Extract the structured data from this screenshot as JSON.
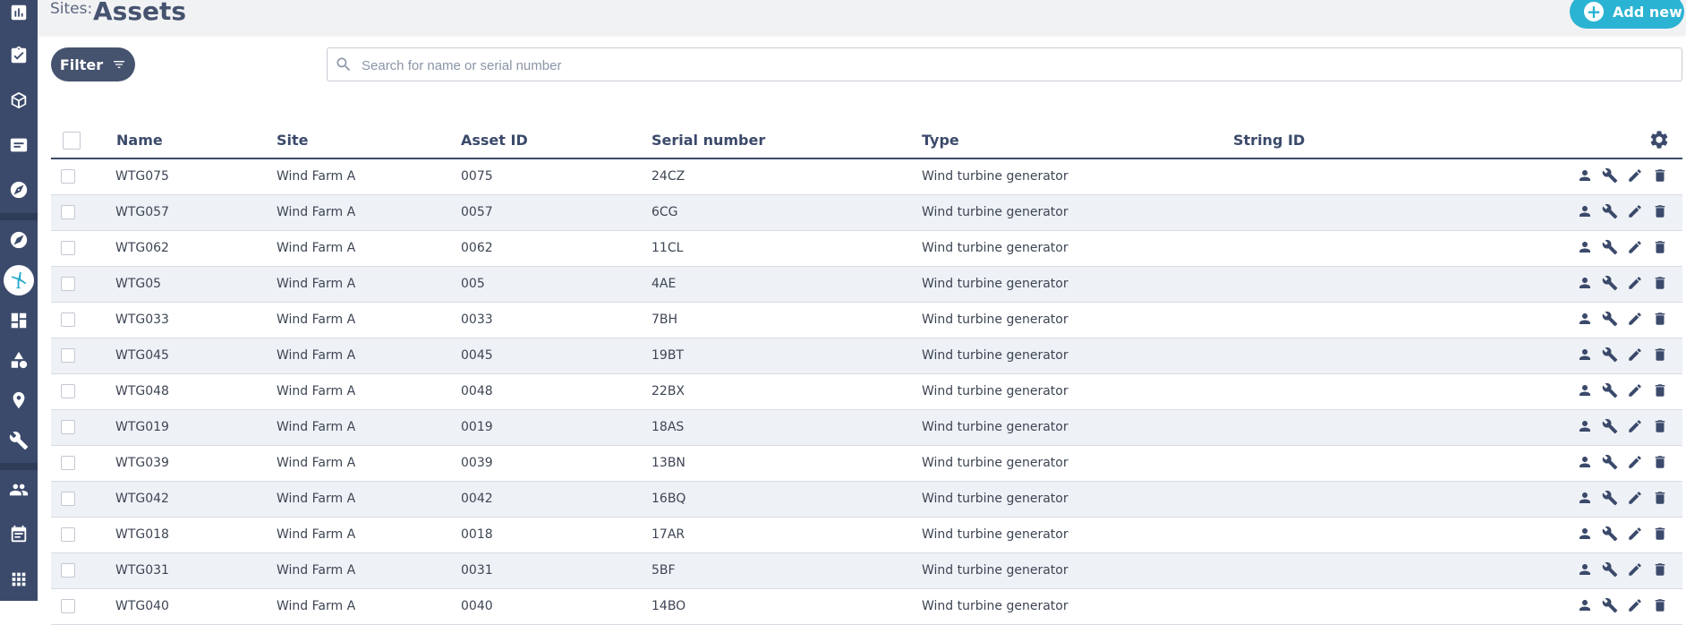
{
  "header": {
    "crumb": "Sites:",
    "title": "Assets",
    "add_new": "Add new"
  },
  "toolbar": {
    "filter": "Filter",
    "search_placeholder": "Search for name or serial number"
  },
  "table": {
    "columns": [
      "Name",
      "Site",
      "Asset ID",
      "Serial number",
      "Type",
      "String ID"
    ],
    "rows": [
      {
        "name": "WTG075",
        "site": "Wind Farm A",
        "asset_id": "0075",
        "serial": "24CZ",
        "type": "Wind turbine generator",
        "string_id": ""
      },
      {
        "name": "WTG057",
        "site": "Wind Farm A",
        "asset_id": "0057",
        "serial": "6CG",
        "type": "Wind turbine generator",
        "string_id": ""
      },
      {
        "name": "WTG062",
        "site": "Wind Farm A",
        "asset_id": "0062",
        "serial": "11CL",
        "type": "Wind turbine generator",
        "string_id": ""
      },
      {
        "name": "WTG05",
        "site": "Wind Farm A",
        "asset_id": "005",
        "serial": "4AE",
        "type": "Wind turbine generator",
        "string_id": ""
      },
      {
        "name": "WTG033",
        "site": "Wind Farm A",
        "asset_id": "0033",
        "serial": "7BH",
        "type": "Wind turbine generator",
        "string_id": ""
      },
      {
        "name": "WTG045",
        "site": "Wind Farm A",
        "asset_id": "0045",
        "serial": "19BT",
        "type": "Wind turbine generator",
        "string_id": ""
      },
      {
        "name": "WTG048",
        "site": "Wind Farm A",
        "asset_id": "0048",
        "serial": "22BX",
        "type": "Wind turbine generator",
        "string_id": ""
      },
      {
        "name": "WTG019",
        "site": "Wind Farm A",
        "asset_id": "0019",
        "serial": "18AS",
        "type": "Wind turbine generator",
        "string_id": ""
      },
      {
        "name": "WTG039",
        "site": "Wind Farm A",
        "asset_id": "0039",
        "serial": "13BN",
        "type": "Wind turbine generator",
        "string_id": ""
      },
      {
        "name": "WTG042",
        "site": "Wind Farm A",
        "asset_id": "0042",
        "serial": "16BQ",
        "type": "Wind turbine generator",
        "string_id": ""
      },
      {
        "name": "WTG018",
        "site": "Wind Farm A",
        "asset_id": "0018",
        "serial": "17AR",
        "type": "Wind turbine generator",
        "string_id": ""
      },
      {
        "name": "WTG031",
        "site": "Wind Farm A",
        "asset_id": "0031",
        "serial": "5BF",
        "type": "Wind turbine generator",
        "string_id": ""
      },
      {
        "name": "WTG040",
        "site": "Wind Farm A",
        "asset_id": "0040",
        "serial": "14BO",
        "type": "Wind turbine generator",
        "string_id": ""
      }
    ]
  },
  "sidebar": {
    "icons": [
      "chart-icon",
      "clipboard-check-icon",
      "package-icon",
      "list-card-icon",
      "compass-icon",
      "compass-outline-icon",
      "wind-turbine-icon",
      "dashboard-icon",
      "shapes-icon",
      "location-pin-icon",
      "wrench-icon",
      "people-icon",
      "calendar-list-icon",
      "apps-grid-icon"
    ],
    "active": "wind-turbine-icon"
  },
  "colors": {
    "sidebar": "#3b4a6b",
    "accent": "#2bb3d3",
    "primary_button": "#46536f",
    "row_alt": "#eef1f6"
  }
}
